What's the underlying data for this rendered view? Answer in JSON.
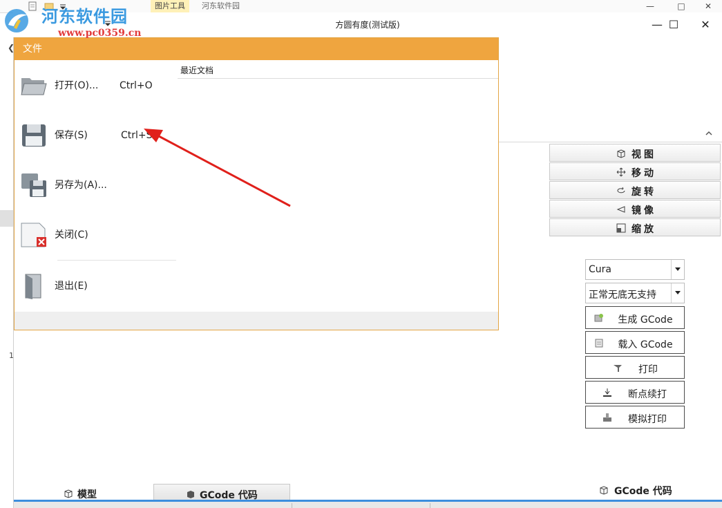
{
  "outer": {
    "ribbon_tab": "图片工具",
    "site_name": "河东软件园",
    "minimize_glyph": "—",
    "maximize_glyph": "□",
    "close_glyph": "✕"
  },
  "watermark": {
    "title": "河东软件园",
    "url": "www.pc0359.cn"
  },
  "window": {
    "title": "方圆有度(测试版)",
    "minimize_glyph": "—",
    "maximize_glyph": "☐",
    "close_glyph": "✕"
  },
  "file_menu": {
    "header": "文件",
    "items": [
      {
        "label": "打开(O)...",
        "shortcut": "Ctrl+O",
        "icon": "folder-open-icon"
      },
      {
        "label": "保存(S)",
        "shortcut": "Ctrl+S",
        "icon": "floppy-disk-icon"
      },
      {
        "label": "另存为(A)...",
        "shortcut": "",
        "icon": "save-as-icon"
      },
      {
        "label": "关闭(C)",
        "shortcut": "",
        "icon": "close-document-icon"
      },
      {
        "label": "退出(E)",
        "shortcut": "",
        "icon": "exit-door-icon"
      }
    ],
    "recent_title": "最近文档"
  },
  "view_buttons": [
    {
      "label": "视图",
      "icon": "cube-view-icon"
    },
    {
      "label": "移动",
      "icon": "move-arrows-icon"
    },
    {
      "label": "旋转",
      "icon": "rotate-icon"
    },
    {
      "label": "镜像",
      "icon": "mirror-icon"
    },
    {
      "label": "缩放",
      "icon": "scale-icon"
    }
  ],
  "settings": {
    "slicer": "Cura",
    "profile": "正常无底无支持"
  },
  "actions": [
    {
      "label": "生成 GCode",
      "icon": "generate-gcode-icon"
    },
    {
      "label": "载入 GCode",
      "icon": "load-gcode-icon"
    },
    {
      "label": "打印",
      "icon": "print-icon"
    },
    {
      "label": "断点续打",
      "icon": "resume-print-icon"
    },
    {
      "label": "模拟打印",
      "icon": "simulate-print-icon"
    }
  ],
  "bottom_tabs": {
    "model": "模型",
    "gcode": "GCode 代码",
    "gcode_right": "GCode 代码"
  },
  "left_fragments": {
    "arrow": "❮",
    "number": "1"
  },
  "colors": {
    "accent_orange": "#efa53f",
    "tab_blue": "#3c8ede",
    "arrow_red": "#e0201b"
  }
}
